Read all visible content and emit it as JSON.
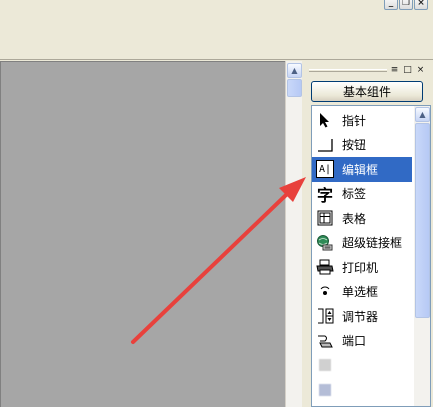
{
  "window": {
    "minimize_glyph": "_",
    "restore_glyph": "❐",
    "close_glyph": "×"
  },
  "panel": {
    "section_title": "基本组件",
    "components": [
      {
        "label": "指针",
        "icon": "pointer-arrow-icon"
      },
      {
        "label": "按钮",
        "icon": "button-icon"
      },
      {
        "label": "编辑框",
        "icon": "edit-box-icon",
        "selected": true
      },
      {
        "label": "标签",
        "icon": "label-char-icon"
      },
      {
        "label": "表格",
        "icon": "table-icon"
      },
      {
        "label": "超级链接框",
        "icon": "hyperlink-icon"
      },
      {
        "label": "打印机",
        "icon": "printer-icon"
      },
      {
        "label": "单选框",
        "icon": "radio-icon"
      },
      {
        "label": "调节器",
        "icon": "spinner-icon"
      },
      {
        "label": "端口",
        "icon": "port-icon"
      },
      {
        "label": "",
        "icon": "blurred-icon"
      },
      {
        "label": "",
        "icon": "blurred-icon"
      }
    ],
    "label_char": "字",
    "edit_box_text": "A|"
  },
  "colors": {
    "selection": "#316ac5",
    "canvas": "#a6a6a6",
    "annotation_arrow": "#e8413c"
  }
}
